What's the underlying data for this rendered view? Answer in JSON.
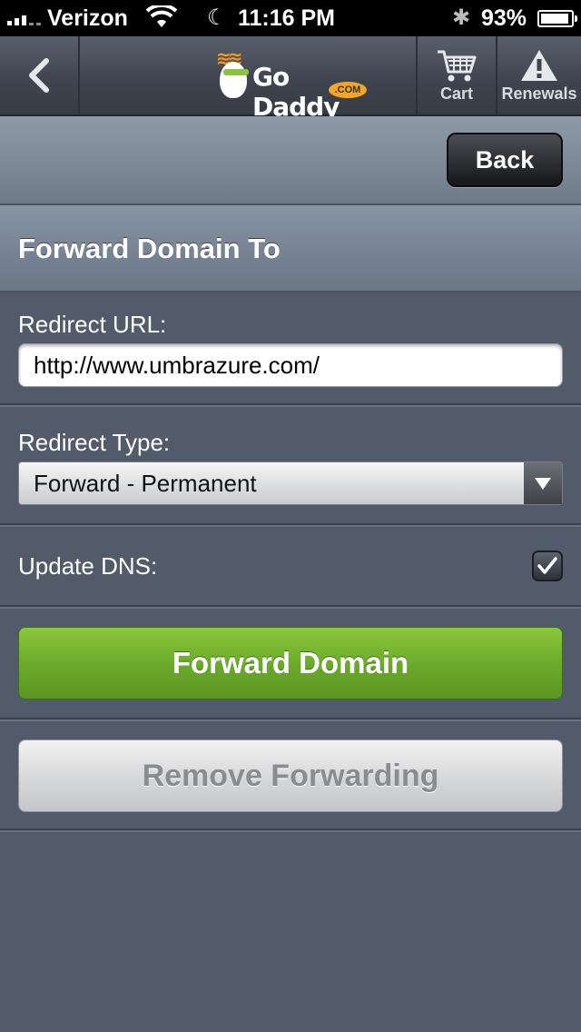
{
  "status_bar": {
    "carrier": "Verizon",
    "time": "11:16 PM",
    "battery": "93%",
    "battery_level": 0.93
  },
  "header": {
    "logo_text": "Go Daddy",
    "logo_suffix": ".COM",
    "cart_label": "Cart",
    "renewals_label": "Renewals"
  },
  "backbar": {
    "back_label": "Back"
  },
  "page": {
    "title": "Forward Domain To"
  },
  "form": {
    "redirect_url_label": "Redirect URL:",
    "redirect_url_value": "http://www.umbrazure.com/",
    "redirect_type_label": "Redirect Type:",
    "redirect_type_value": "Forward - Permanent",
    "update_dns_label": "Update DNS:",
    "update_dns_checked": true,
    "forward_button": "Forward Domain",
    "remove_button": "Remove Forwarding"
  },
  "colors": {
    "background": "#525b6a",
    "accent_green": "#6aa82a",
    "logo_orange": "#f59b1f"
  }
}
